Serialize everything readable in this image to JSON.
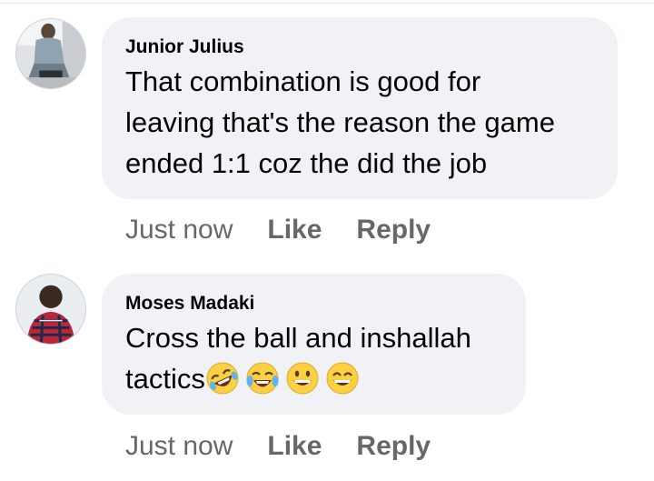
{
  "comments": [
    {
      "author": "Junior Julius",
      "text": "That combination is good for\nleaving that's the reason the game\nended 1:1 coz the did the job",
      "time": "Just now",
      "like_label": "Like",
      "reply_label": "Reply",
      "avatar_icon": "user-photo-avatar"
    },
    {
      "author": "Moses Madaki",
      "text": "Cross the ball and inshallah\ntactics",
      "emojis": [
        "rofl-emoji",
        "tears-of-joy-emoji",
        "grinning-emoji",
        "smiling-eyes-emoji"
      ],
      "time": "Just now",
      "like_label": "Like",
      "reply_label": "Reply",
      "avatar_icon": "user-photo-avatar"
    }
  ],
  "colors": {
    "bubble": "#f0f2f5",
    "text": "#050505",
    "meta": "#65676b"
  }
}
